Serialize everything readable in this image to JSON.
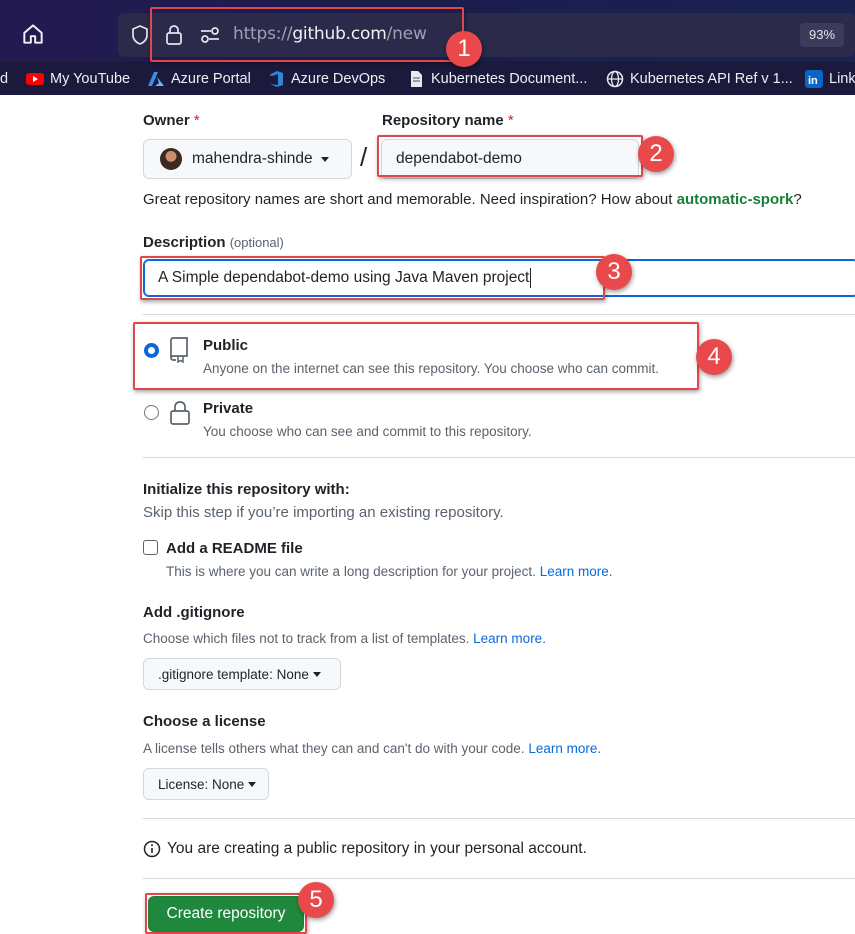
{
  "browser": {
    "url_scheme": "https://",
    "url_host": "github.com",
    "url_path": "/new",
    "zoom": "93%",
    "bookmarks": [
      {
        "label": "d",
        "icon": "none"
      },
      {
        "label": "My YouTube",
        "icon": "youtube-icon"
      },
      {
        "label": "Azure Portal",
        "icon": "azure-icon"
      },
      {
        "label": "Azure DevOps",
        "icon": "azure-devops-icon"
      },
      {
        "label": "Kubernetes Document...",
        "icon": "document-icon"
      },
      {
        "label": "Kubernetes API Ref v 1...",
        "icon": "globe-icon"
      },
      {
        "label": "Link",
        "icon": "linkedin-icon"
      }
    ]
  },
  "form": {
    "owner_label": "Owner",
    "repo_name_label": "Repository name",
    "required_mark": "*",
    "owner_value": "mahendra-shinde",
    "slash": "/",
    "repo_name_value": "dependabot-demo",
    "name_hint_text": "Great repository names are short and memorable. Need inspiration? How about ",
    "name_hint_suggestion": "automatic-spork",
    "name_hint_end": "?",
    "description_label": "Description",
    "description_optional": "(optional)",
    "description_value": "A Simple dependabot-demo using Java Maven project",
    "visibility": {
      "public_title": "Public",
      "public_desc": "Anyone on the internet can see this repository. You choose who can commit.",
      "private_title": "Private",
      "private_desc": "You choose who can see and commit to this repository.",
      "selected": "public"
    },
    "init_title": "Initialize this repository with:",
    "init_subtitle": "Skip this step if you’re importing an existing repository.",
    "readme_label": "Add a README file",
    "readme_desc": "This is where you can write a long description for your project.",
    "readme_link": "Learn more.",
    "readme_checked": false,
    "gitignore_title": "Add .gitignore",
    "gitignore_desc": "Choose which files not to track from a list of templates.",
    "gitignore_link": "Learn more.",
    "gitignore_select": ".gitignore template: None",
    "license_title": "Choose a license",
    "license_desc": "A license tells others what they can and can't do with your code.",
    "license_link": "Learn more.",
    "license_select": "License: None",
    "info_text": "You are creating a public repository in your personal account.",
    "create_button": "Create repository"
  },
  "annotations": [
    "1",
    "2",
    "3",
    "4",
    "5"
  ],
  "colors": {
    "primary_button": "#1f883d",
    "link_blue": "#0969da",
    "suggestion_green": "#1a7f37",
    "annotation_red": "#e0464a"
  }
}
